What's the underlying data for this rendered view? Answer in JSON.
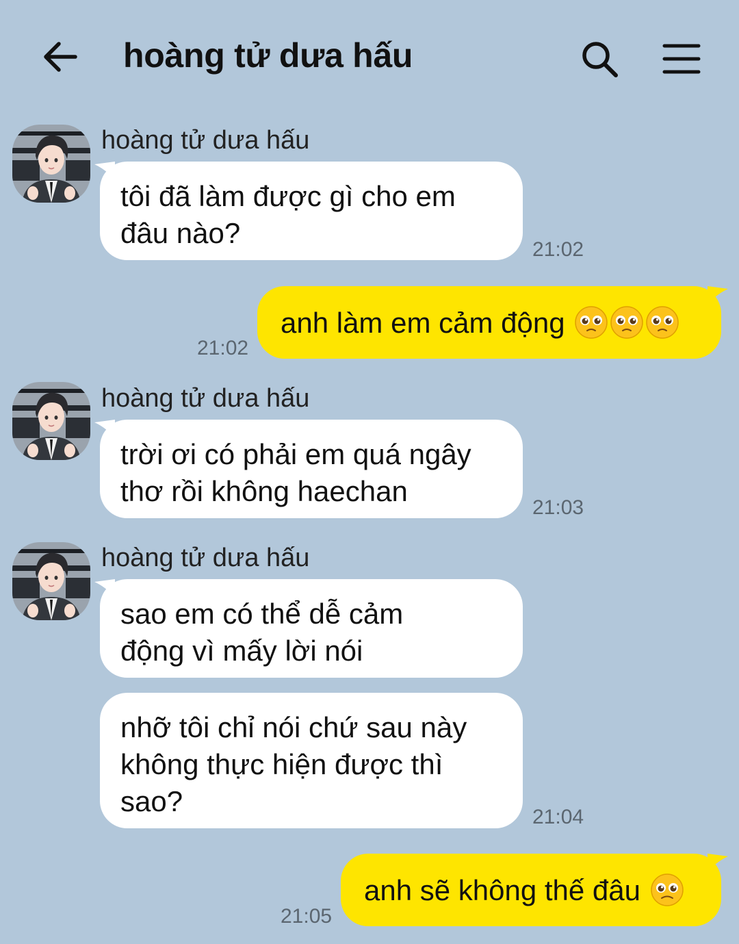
{
  "header": {
    "title": "hoàng tử dưa hấu"
  },
  "colors": {
    "background": "#b2c7da",
    "incoming_bubble": "#ffffff",
    "outgoing_bubble": "#fee500"
  },
  "messages": [
    {
      "direction": "in",
      "sender": "hoàng tử dưa hấu",
      "text": "tôi đã làm được gì cho em\nđâu nào?",
      "time": "21:02"
    },
    {
      "direction": "out",
      "text": "anh làm em cảm động",
      "emojis": [
        "pleading-face",
        "pleading-face",
        "pleading-face"
      ],
      "time": "21:02"
    },
    {
      "direction": "in",
      "sender": "hoàng tử dưa hấu",
      "text": "trời ơi có phải em quá ngây\nthơ rồi không haechan",
      "time": "21:03"
    },
    {
      "direction": "in",
      "sender": "hoàng tử dưa hấu",
      "text": "sao em có thể dễ cảm\nđộng vì mấy lời nói",
      "time": ""
    },
    {
      "direction": "in",
      "text": "nhỡ tôi chỉ nói chứ sau này\nkhông thực hiện được thì\nsao?",
      "time": "21:04"
    },
    {
      "direction": "out",
      "text": "anh sẽ không thế đâu",
      "emojis": [
        "pleading-face"
      ],
      "time": "21:05"
    }
  ]
}
